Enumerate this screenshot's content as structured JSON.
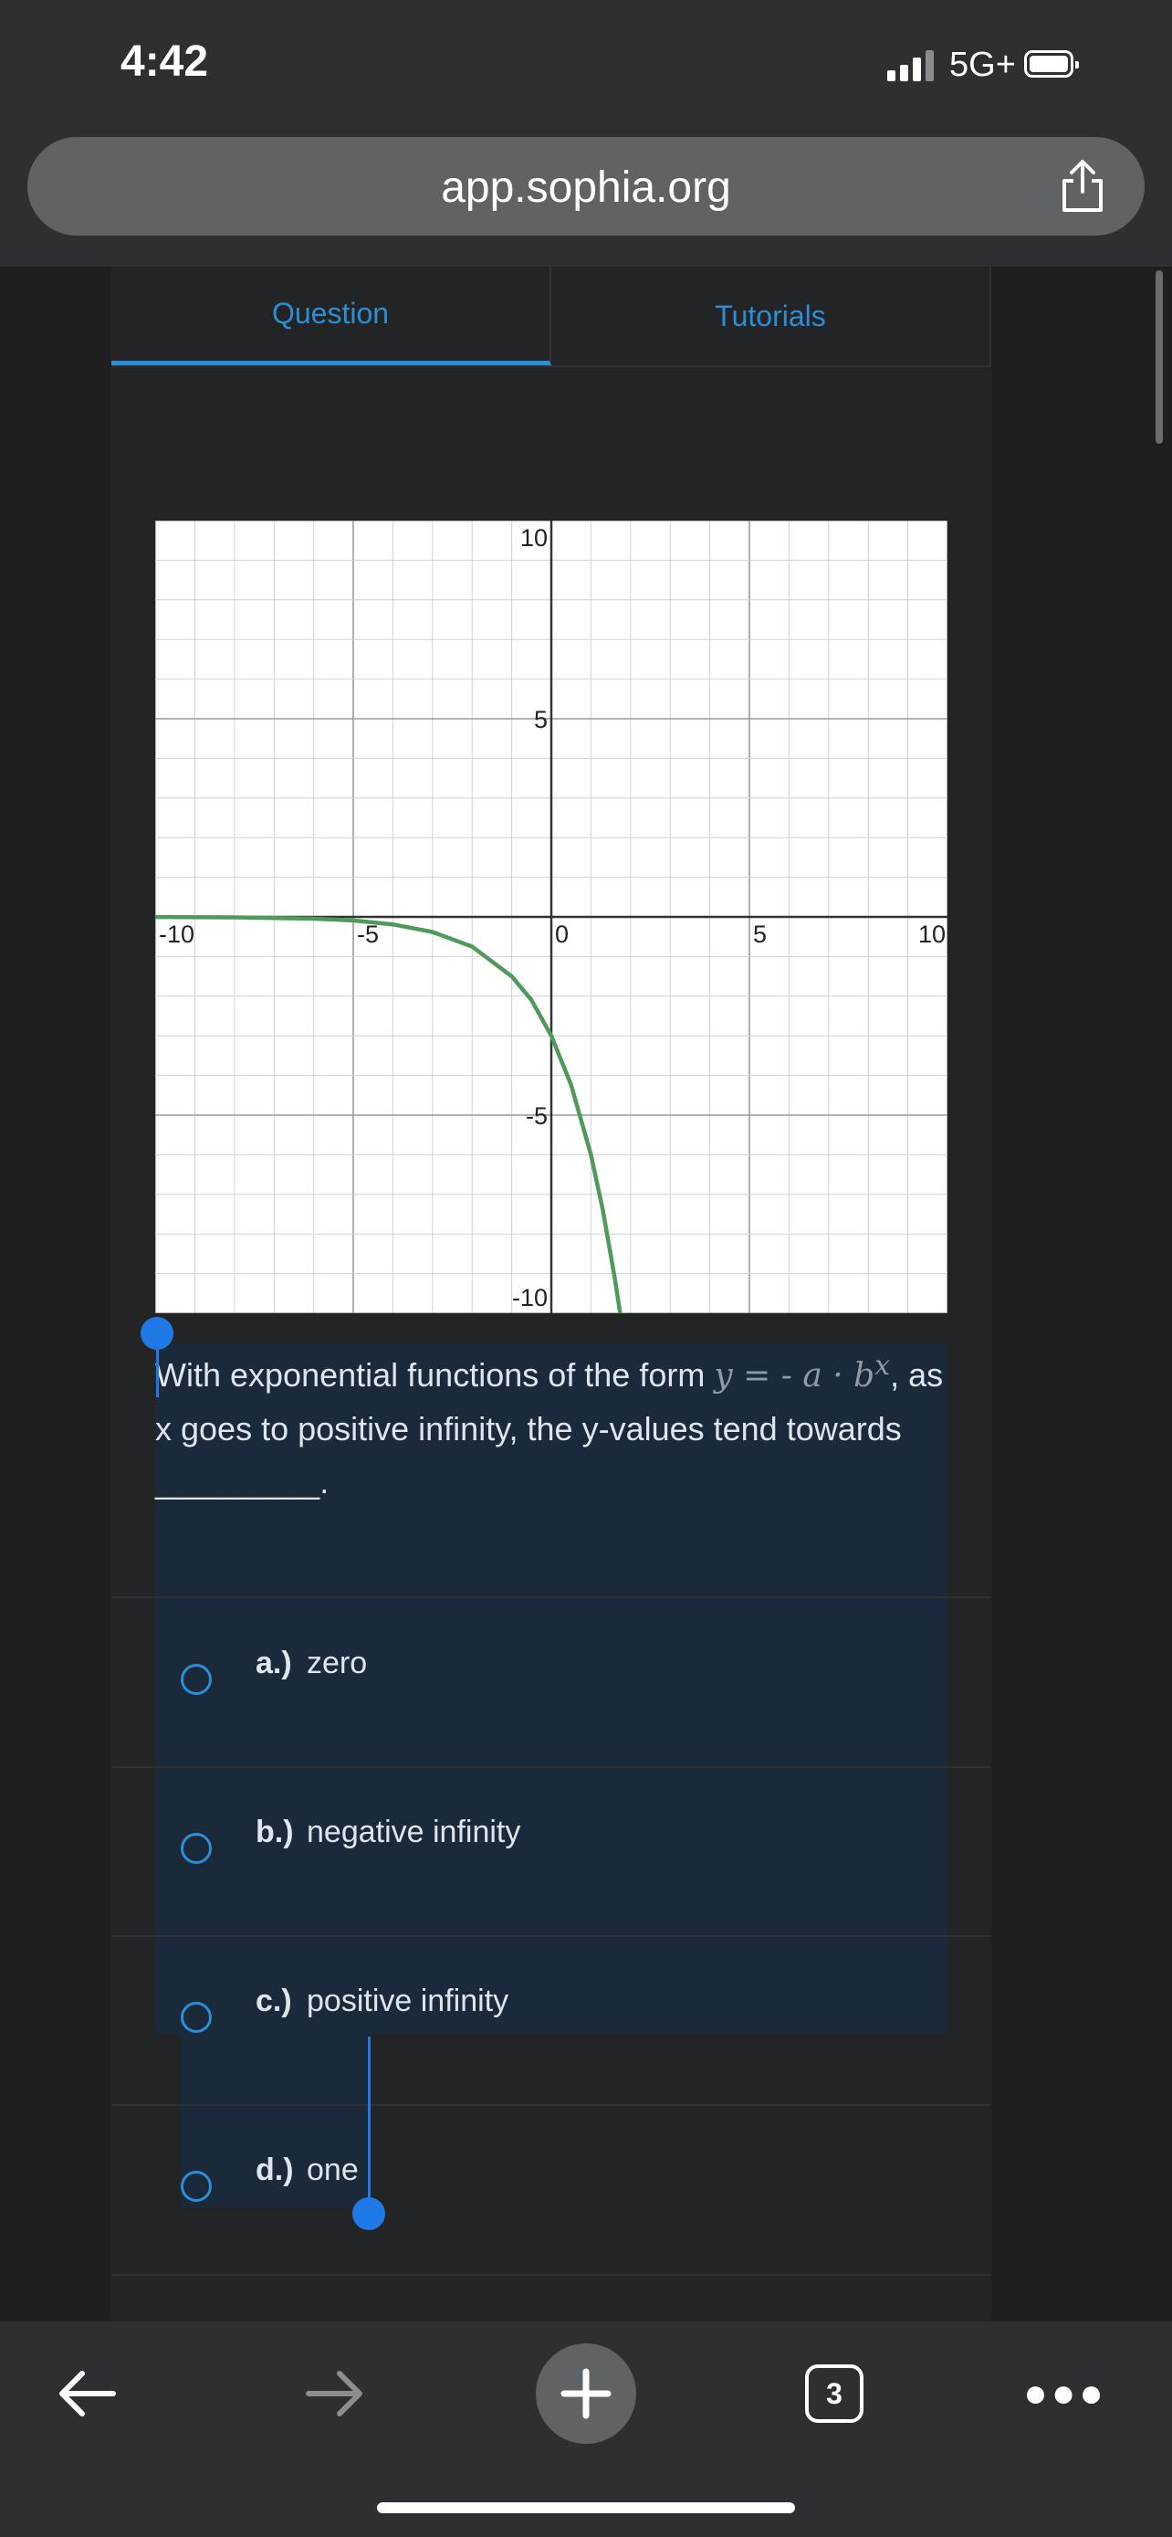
{
  "status_bar": {
    "time": "4:42",
    "network": "5G+"
  },
  "browser": {
    "url": "app.sophia.org",
    "tab_count": "3"
  },
  "tabs": [
    {
      "label": "Question",
      "active": true
    },
    {
      "label": "Tutorials",
      "active": false
    }
  ],
  "chart_data": {
    "type": "line",
    "xlim": [
      -10,
      10
    ],
    "ylim": [
      -10,
      10
    ],
    "x_ticks": [
      "-10",
      "-5",
      "0",
      "5",
      "10"
    ],
    "y_ticks": [
      "10",
      "5",
      "-5",
      "-10"
    ],
    "grid": true,
    "series": [
      {
        "color": "#4f9a5a",
        "x": [
          -10,
          -8,
          -6,
          -5,
          -4,
          -3,
          -2,
          -1,
          -0.5,
          0,
          0.5,
          1,
          1.3,
          1.6,
          1.8
        ],
        "y": [
          -0.003,
          -0.012,
          -0.047,
          -0.09,
          -0.19,
          -0.38,
          -0.75,
          -1.5,
          -2.1,
          -3,
          -4.24,
          -6,
          -7.39,
          -9.1,
          -10.4
        ]
      }
    ]
  },
  "question": {
    "lead": "With exponential functions of the form ",
    "formula": "y = - a · b",
    "exponent": "x",
    "tail": ", as x goes to positive infinity, the y-values tend towards _________."
  },
  "options": [
    {
      "letter": "a.)",
      "text": "zero"
    },
    {
      "letter": "b.)",
      "text": "negative infinity"
    },
    {
      "letter": "c.)",
      "text": "positive infinity"
    },
    {
      "letter": "d.)",
      "text": "one"
    }
  ],
  "colors": {
    "accent": "#2b8fd6",
    "selection": "#1b2a3b",
    "curve": "#4f9a5a"
  }
}
